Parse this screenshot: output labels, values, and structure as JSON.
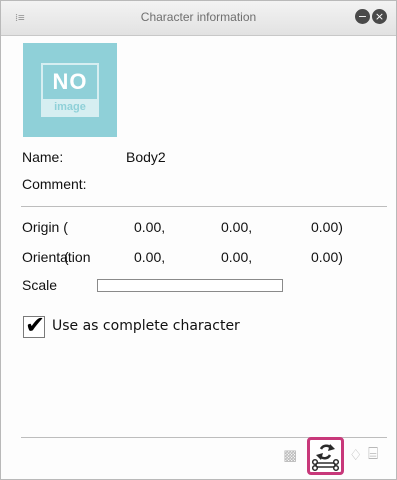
{
  "window": {
    "title": "Character information",
    "grip_glyph": "⁞≡",
    "min_glyph": "−",
    "close_glyph": "×"
  },
  "thumbnail": {
    "line1": "NO",
    "line2": "image"
  },
  "fields": {
    "name_label": "Name:",
    "name_value": "Body2",
    "comment_label": "Comment:"
  },
  "transform": {
    "origin": {
      "label": "Origin (",
      "x": "0.00,",
      "y": "0.00,",
      "z": "0.00)"
    },
    "orientation": {
      "label": "Orientation",
      "paren": "(",
      "x": "0.00,",
      "y": "0.00,",
      "z": "0.00)"
    },
    "scale": {
      "label": "Scale"
    }
  },
  "option": {
    "label": "Use as complete character",
    "checked": true,
    "check_glyph": "✔"
  },
  "toolbar": {
    "icons": [
      {
        "name": "grid-icon",
        "glyph": "▩"
      },
      {
        "name": "refresh-bone-icon",
        "glyph": "⟳"
      },
      {
        "name": "pen-icon",
        "glyph": "♢"
      },
      {
        "name": "stand-icon",
        "glyph": "⌸"
      }
    ]
  },
  "colors": {
    "accent_highlight": "#c8387a",
    "thumbnail_bg": "#8fd0d8"
  }
}
